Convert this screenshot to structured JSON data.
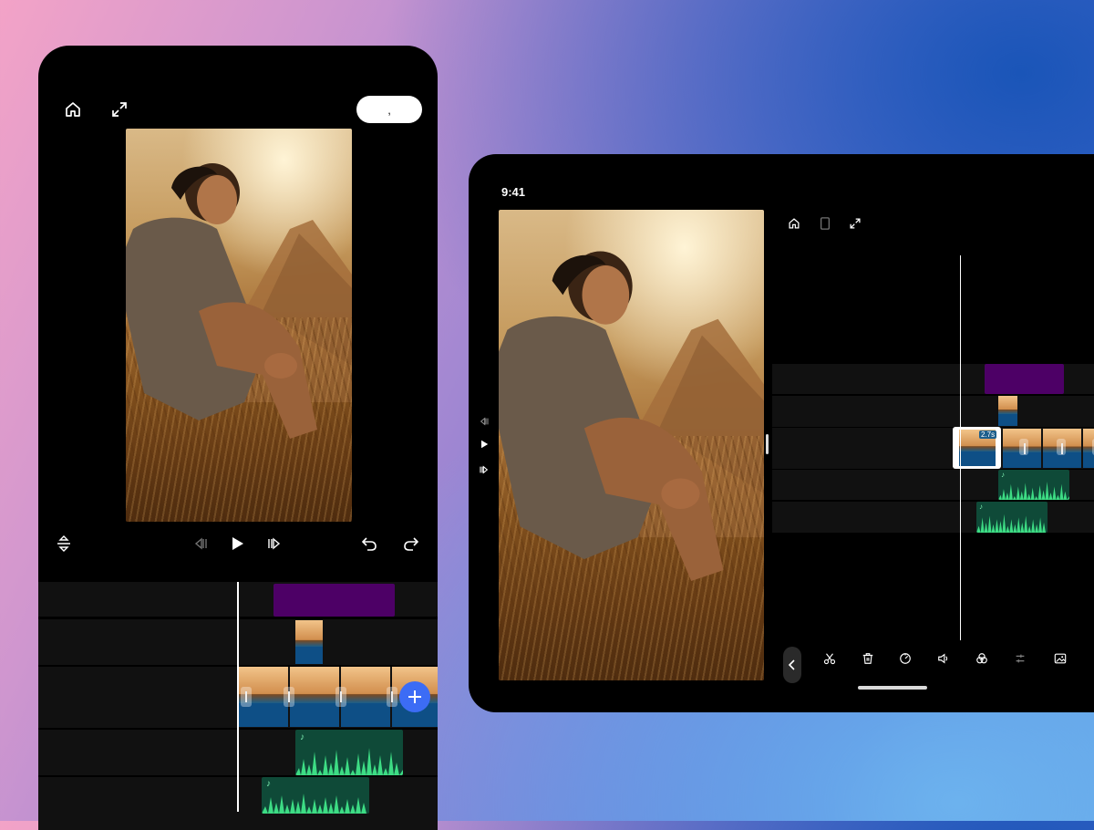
{
  "phone": {
    "top_icons": {
      "home": "home-icon",
      "fullscreen": "expand-icon"
    },
    "pill_button_label": ",",
    "controls": {
      "split": "split-vertical-icon",
      "prev_frame": "prev-frame-icon",
      "play": "play-icon",
      "next_frame": "next-frame-icon",
      "undo": "undo-icon",
      "redo": "redo-icon"
    },
    "add_button_icon": "plus-icon",
    "audio_icon": "music-note-icon"
  },
  "tablet": {
    "status_time": "9:41",
    "top_icons": [
      "home-icon",
      "device-icon",
      "expand-icon"
    ],
    "side_controls": [
      "prev-frame-icon",
      "play-icon",
      "next-frame-icon"
    ],
    "clip_duration_badge": "2.7s",
    "toolbar": [
      "scissors-icon",
      "trash-icon",
      "speed-icon",
      "volume-icon",
      "filters-icon",
      "adjust-icon",
      "image-icon"
    ],
    "back_icon": "chevron-left-icon"
  },
  "colors": {
    "background_gradient": [
      "#f3a3c7",
      "#9e86d2",
      "#1a55b8",
      "#6cb2ee"
    ],
    "accent_blue": "#3c6cf5",
    "overlay_clip": "#4d0066",
    "audio_clip": "#0f4a38",
    "audio_wave": "#3ddc84"
  }
}
